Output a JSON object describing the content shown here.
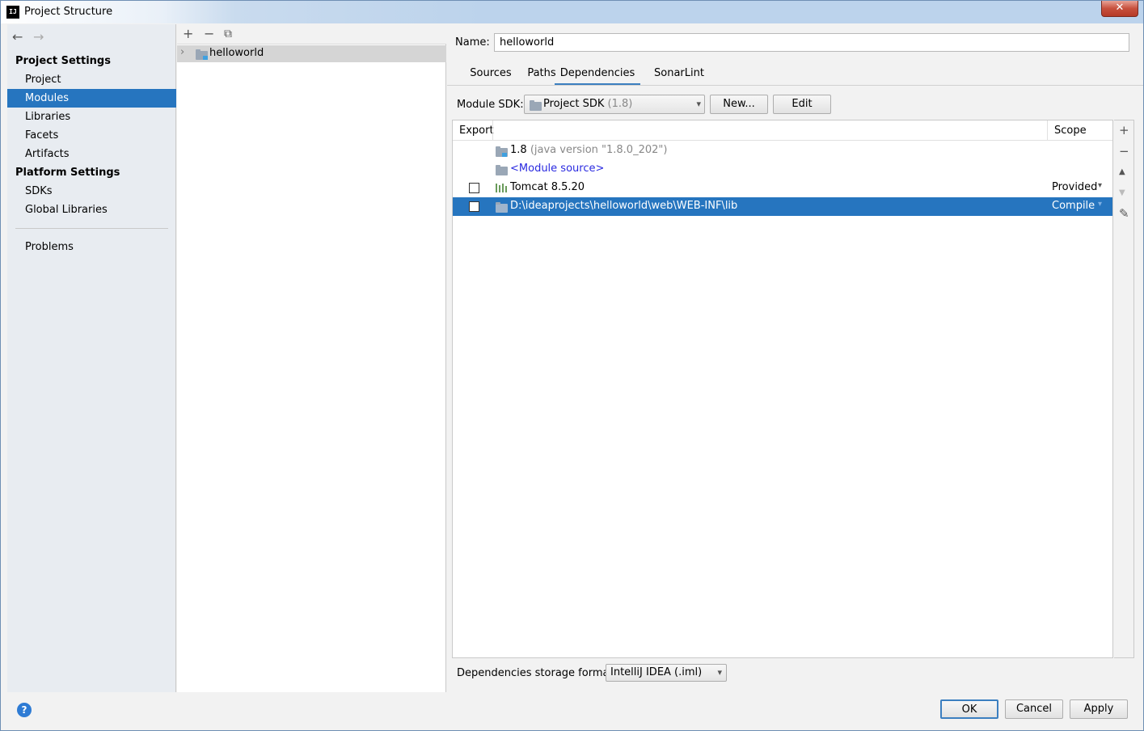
{
  "window": {
    "title": "Project Structure",
    "icon_text": "IJ",
    "close_label": "✕"
  },
  "nav": {
    "back_icon": "←",
    "forward_icon": "→",
    "project_settings_title": "Project Settings",
    "project_settings_items": [
      "Project",
      "Modules",
      "Libraries",
      "Facets",
      "Artifacts"
    ],
    "selected_item": "Modules",
    "platform_settings_title": "Platform Settings",
    "platform_settings_items": [
      "SDKs",
      "Global Libraries"
    ],
    "problems_label": "Problems"
  },
  "tree": {
    "toolbar": {
      "add_icon": "+",
      "remove_icon": "−",
      "copy_icon": "⧉"
    },
    "chevron": "›",
    "module_name": "helloworld"
  },
  "module": {
    "name_label": "Name:",
    "name_value": "helloworld",
    "tabs": [
      "Sources",
      "Paths",
      "Dependencies",
      "SonarLint"
    ],
    "active_tab": "Dependencies",
    "sdk_label": "Module SDK:",
    "sdk_value": "Project SDK",
    "sdk_version": "(1.8)",
    "new_button": "New...",
    "edit_button": "Edit",
    "caret": "▾"
  },
  "dependencies": {
    "columns": {
      "export": "Export",
      "scope": "Scope"
    },
    "rows": [
      {
        "name": "1.8",
        "detail": "(java version \"1.8.0_202\")",
        "checkbox": false,
        "scope": "",
        "selected": false
      },
      {
        "name": "<Module source>",
        "detail": "",
        "checkbox": false,
        "scope": "",
        "selected": false
      },
      {
        "name": "Tomcat 8.5.20",
        "detail": "",
        "checkbox": true,
        "scope": "Provided",
        "selected": false
      },
      {
        "name": "D:\\ideaprojects\\helloworld\\web\\WEB-INF\\lib",
        "detail": "",
        "checkbox": true,
        "scope": "Compile",
        "selected": true
      }
    ],
    "side_tools": {
      "add_icon": "+",
      "remove_icon": "−",
      "up_icon": "▲",
      "down_icon": "▼",
      "edit_icon": "✎"
    },
    "storage_label": "Dependencies storage format:",
    "storage_value": "IntelliJ IDEA (.iml)"
  },
  "footer": {
    "help_icon": "?",
    "ok": "OK",
    "cancel": "Cancel",
    "apply": "Apply"
  },
  "colors": {
    "selection": "#2675bf",
    "tab_underline": "#3c7fc0",
    "link": "#2a2ae0"
  }
}
